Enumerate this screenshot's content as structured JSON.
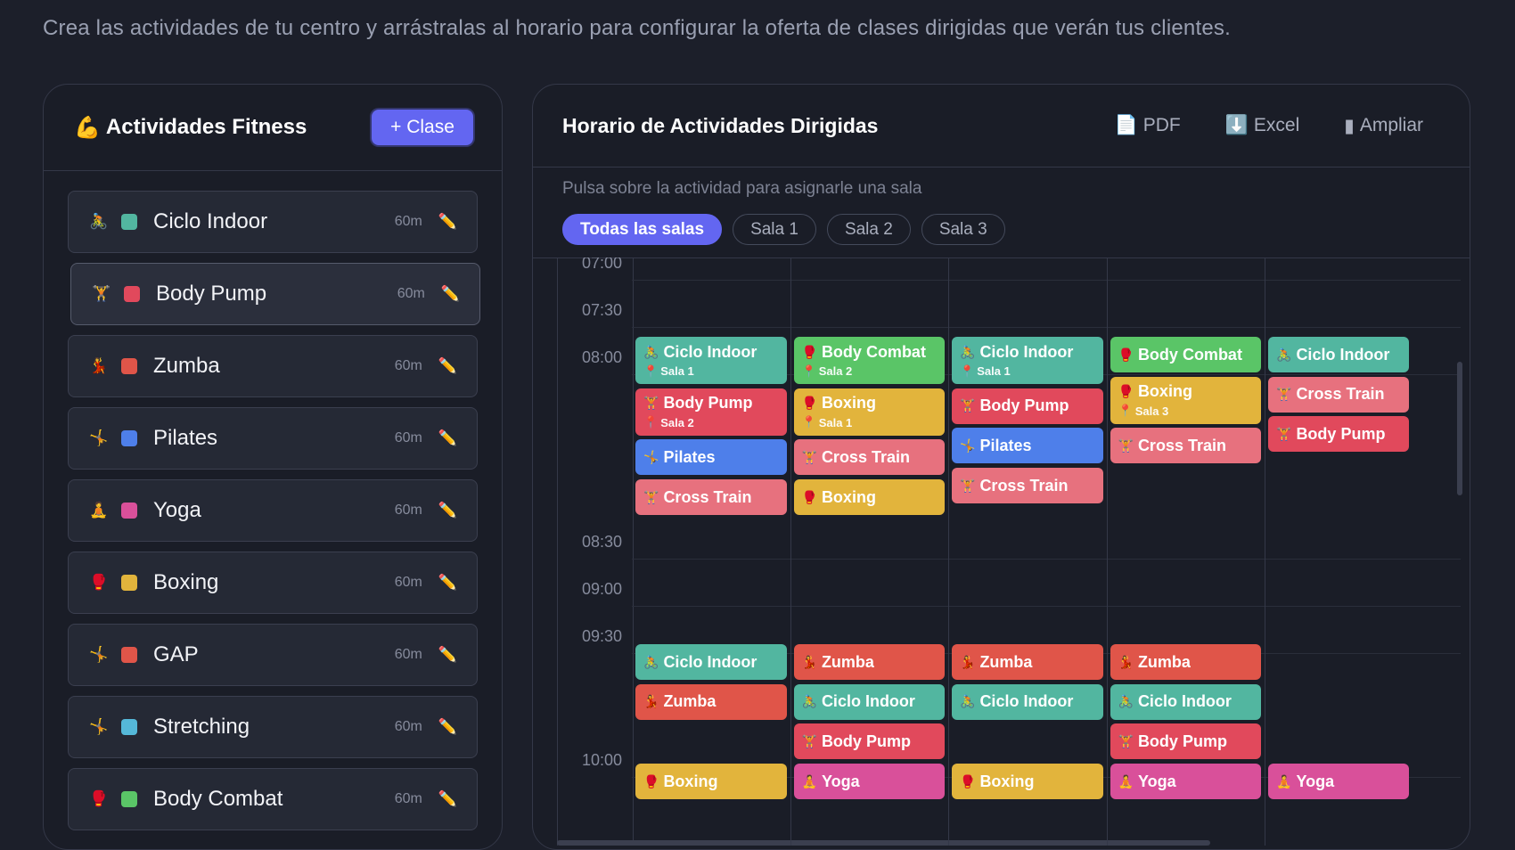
{
  "intro": "Crea las actividades de tu centro y arrástralas al horario para configurar la oferta de clases dirigidas que verán tus clientes.",
  "colors": {
    "accent": "#6366f1",
    "teal": "#52b6a0",
    "red": "#e05549",
    "crimson": "#e1495c",
    "blue": "#4e7fea",
    "pink": "#d9509a",
    "yellow": "#e2b43c",
    "green": "#5ac567",
    "rose": "#e7717e",
    "cyan": "#55b8d9"
  },
  "left": {
    "title_icon": "💪",
    "title": "Actividades Fitness",
    "add_label": "+ Clase",
    "items": [
      {
        "emoji": "🚴",
        "name": "Ciclo Indoor",
        "duration": "60m",
        "color": "#52b6a0",
        "icon": "bike-icon"
      },
      {
        "emoji": "🏋",
        "name": "Body Pump",
        "duration": "60m",
        "color": "#e1495c",
        "icon": "weightlifting-icon"
      },
      {
        "emoji": "💃",
        "name": "Zumba",
        "duration": "60m",
        "color": "#e05549",
        "icon": "dancer-icon"
      },
      {
        "emoji": "🤸",
        "name": "Pilates",
        "duration": "60m",
        "color": "#4e7fea",
        "icon": "stretch-icon"
      },
      {
        "emoji": "🧘",
        "name": "Yoga",
        "duration": "60m",
        "color": "#d9509a",
        "icon": "meditation-icon"
      },
      {
        "emoji": "🥊",
        "name": "Boxing",
        "duration": "60m",
        "color": "#e2b43c",
        "icon": "boxing-glove-icon"
      },
      {
        "emoji": "🤸",
        "name": "GAP",
        "duration": "60m",
        "color": "#e05549",
        "icon": "stretch-icon"
      },
      {
        "emoji": "🤸",
        "name": "Stretching",
        "duration": "60m",
        "color": "#55b8d9",
        "icon": "stretch-icon"
      },
      {
        "emoji": "🥊",
        "name": "Body Combat",
        "duration": "60m",
        "color": "#5ac567",
        "icon": "boxing-glove-icon"
      }
    ],
    "edit_icon": "✏️"
  },
  "right": {
    "title": "Horario de Actividades Dirigidas",
    "tools": [
      {
        "icon": "📄",
        "label": "PDF"
      },
      {
        "icon": "⬇️",
        "label": "Excel"
      },
      {
        "icon": "▮",
        "label": "Ampliar"
      }
    ],
    "hint": "Pulsa sobre la actividad para asignarle una sala",
    "filters": [
      "Todas las salas",
      "Sala 1",
      "Sala 2",
      "Sala 3"
    ],
    "active_filter": "Todas las salas",
    "times": [
      "07:00",
      "07:30",
      "08:00",
      "08:30",
      "09:00",
      "09:30",
      "10:00"
    ],
    "schedule": [
      [
        [
          {
            "e": "🚴",
            "n": "Ciclo Indoor",
            "c": "teal",
            "sala": "Sala 1"
          },
          {
            "e": "🏋",
            "n": "Body Pump",
            "c": "crimson",
            "sala": "Sala 2"
          },
          {
            "e": "🤸",
            "n": "Pilates",
            "c": "blue"
          },
          {
            "e": "🏋",
            "n": "Cross Train",
            "c": "rose"
          }
        ],
        [
          {
            "e": "🥊",
            "n": "Body Combat",
            "c": "green",
            "sala": "Sala 2"
          },
          {
            "e": "🥊",
            "n": "Boxing",
            "c": "yellow",
            "sala": "Sala 1"
          },
          {
            "e": "🏋",
            "n": "Cross Train",
            "c": "rose"
          },
          {
            "e": "🥊",
            "n": "Boxing",
            "c": "yellow"
          }
        ],
        [
          {
            "e": "🚴",
            "n": "Ciclo Indoor",
            "c": "teal",
            "sala": "Sala 1"
          },
          {
            "e": "🏋",
            "n": "Body Pump",
            "c": "crimson"
          },
          {
            "e": "🤸",
            "n": "Pilates",
            "c": "blue"
          },
          {
            "e": "🏋",
            "n": "Cross Train",
            "c": "rose"
          }
        ],
        [
          {
            "e": "🥊",
            "n": "Body Combat",
            "c": "green"
          },
          {
            "e": "🥊",
            "n": "Boxing",
            "c": "yellow",
            "sala": "Sala 3"
          },
          {
            "e": "🏋",
            "n": "Cross Train",
            "c": "rose"
          }
        ],
        [
          {
            "e": "🚴",
            "n": "Ciclo Indoor",
            "c": "teal"
          },
          {
            "e": "🏋",
            "n": "Cross Train",
            "c": "rose"
          },
          {
            "e": "🏋",
            "n": "Body Pump",
            "c": "crimson"
          }
        ]
      ],
      [
        [
          {
            "e": "🚴",
            "n": "Ciclo Indoor",
            "c": "teal"
          },
          {
            "e": "💃",
            "n": "Zumba",
            "c": "red"
          }
        ],
        [
          {
            "e": "💃",
            "n": "Zumba",
            "c": "red"
          },
          {
            "e": "🚴",
            "n": "Ciclo Indoor",
            "c": "teal"
          },
          {
            "e": "🏋",
            "n": "Body Pump",
            "c": "crimson"
          }
        ],
        [
          {
            "e": "💃",
            "n": "Zumba",
            "c": "red"
          },
          {
            "e": "🚴",
            "n": "Ciclo Indoor",
            "c": "teal"
          }
        ],
        [
          {
            "e": "💃",
            "n": "Zumba",
            "c": "red"
          },
          {
            "e": "🚴",
            "n": "Ciclo Indoor",
            "c": "teal"
          },
          {
            "e": "🏋",
            "n": "Body Pump",
            "c": "crimson"
          }
        ],
        []
      ],
      [
        [
          {
            "e": "🥊",
            "n": "Boxing",
            "c": "yellow"
          }
        ],
        [
          {
            "e": "🧘",
            "n": "Yoga",
            "c": "pink"
          }
        ],
        [
          {
            "e": "🥊",
            "n": "Boxing",
            "c": "yellow"
          }
        ],
        [
          {
            "e": "🧘",
            "n": "Yoga",
            "c": "pink"
          }
        ],
        [
          {
            "e": "🧘",
            "n": "Yoga",
            "c": "pink"
          }
        ]
      ]
    ],
    "pin_icon": "📍"
  }
}
